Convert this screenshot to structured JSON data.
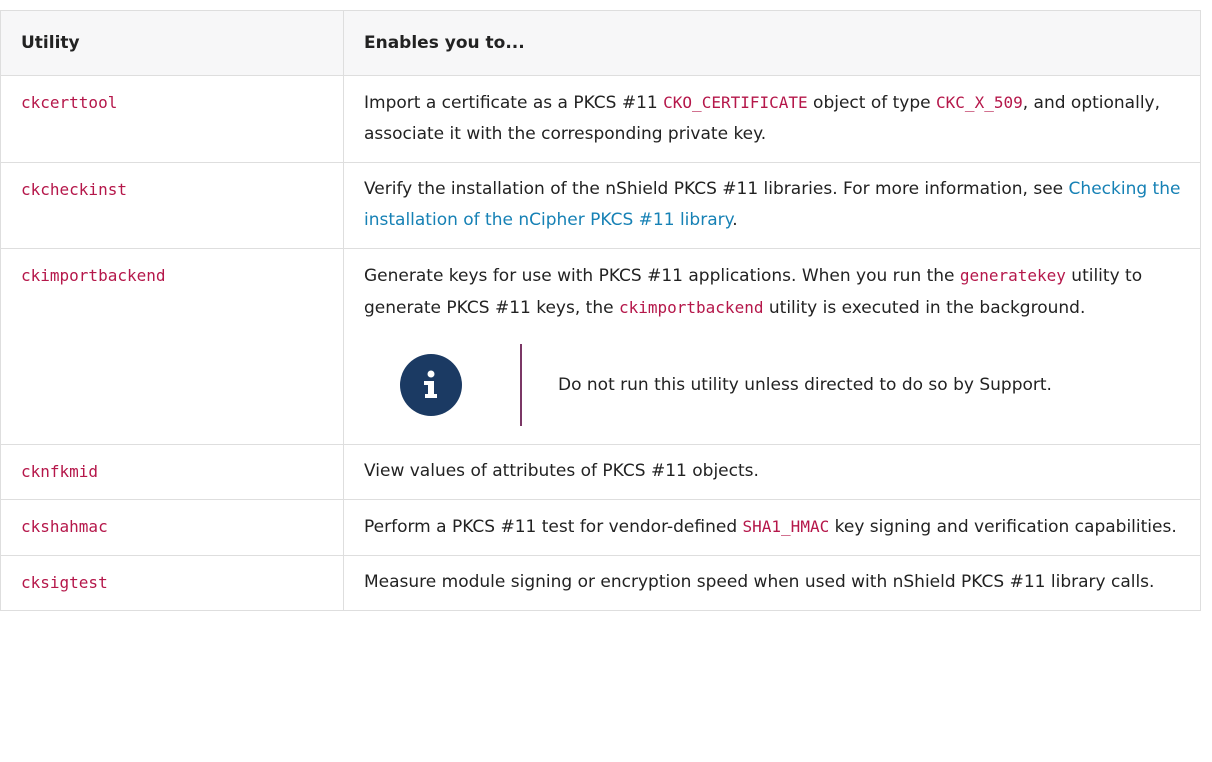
{
  "table": {
    "headers": [
      "Utility",
      "Enables you to..."
    ],
    "rows": [
      {
        "utility": "ckcerttool",
        "desc": {
          "p1": "Import a certificate as a PKCS #11 ",
          "c1": "CKO_CERTIFICATE",
          "p2": " object of type ",
          "c2": "CKC_X_509",
          "p3": ", and optionally, associate it with the corresponding private key."
        }
      },
      {
        "utility": "ckcheckinst",
        "desc": {
          "p1": "Verify the installation of the nShield PKCS #11 libraries. For more information, see ",
          "link": "Checking the installation of the nCipher PKCS #11 library",
          "p2": "."
        }
      },
      {
        "utility": "ckimportbackend",
        "desc": {
          "p1": "Generate keys for use with PKCS #11 applications. When you run the ",
          "c1": "generatekey",
          "p2": " utility to generate PKCS #11 keys, the ",
          "c2": "ckimportbackend",
          "p3": " utility is executed in the background."
        },
        "note": {
          "icon": "info-icon",
          "text": "Do not run this utility unless directed to do so by Support."
        }
      },
      {
        "utility": "cknfkmid",
        "desc": {
          "p1": "View values of attributes of PKCS #11 objects."
        }
      },
      {
        "utility": "ckshahmac",
        "desc": {
          "p1": "Perform a PKCS #11 test for vendor-defined ",
          "c1": "SHA1_HMAC",
          "p2": " key signing and verification capabilities."
        }
      },
      {
        "utility": "cksigtest",
        "desc": {
          "p1": "Measure module signing or encryption speed when used with nShield PKCS #11 library calls."
        }
      }
    ]
  },
  "colors": {
    "code": "#b5174a",
    "link": "#1681b5",
    "header_bg": "#f7f7f8",
    "note_icon_bg": "#1b3a63",
    "note_divider": "#7b3766"
  }
}
